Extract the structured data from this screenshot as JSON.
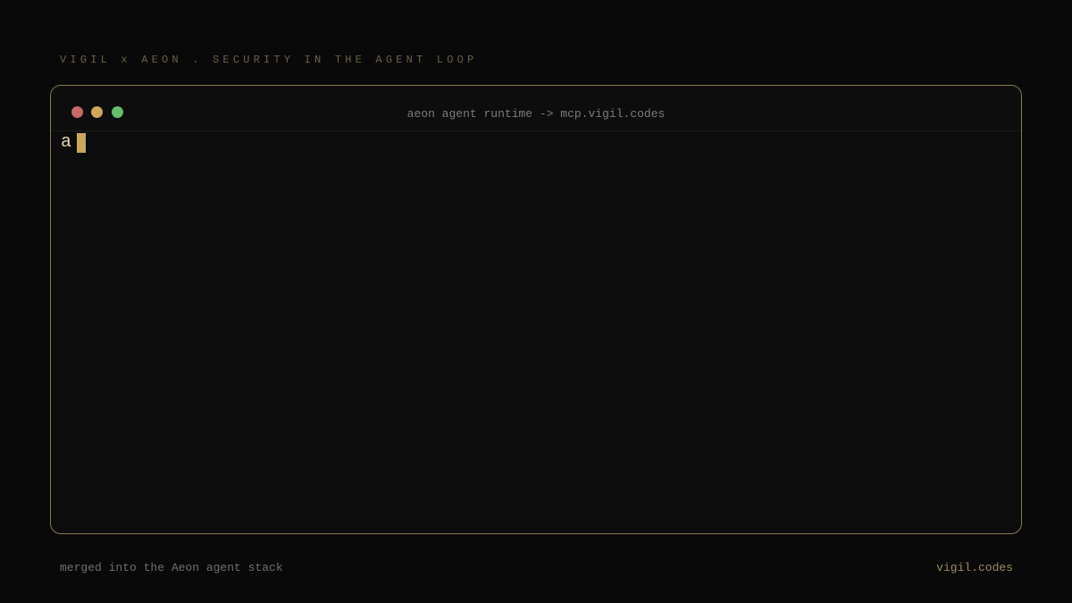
{
  "header": {
    "kicker": "VIGIL x AEON . SECURITY IN THE AGENT LOOP"
  },
  "window": {
    "title": "aeon agent runtime -> mcp.vigil.codes",
    "traffic_lights": [
      {
        "name": "close",
        "color": "#c96868"
      },
      {
        "name": "minimize",
        "color": "#d1a85a"
      },
      {
        "name": "zoom",
        "color": "#66bf6c"
      }
    ]
  },
  "terminal": {
    "text": "a",
    "cursor_color": "#c9a85c"
  },
  "footer": {
    "left": "merged into the Aeon agent stack",
    "right": "vigil.codes"
  },
  "colors": {
    "background": "#090909",
    "window_border": "#8c7a52",
    "accent": "#c9a85c"
  }
}
